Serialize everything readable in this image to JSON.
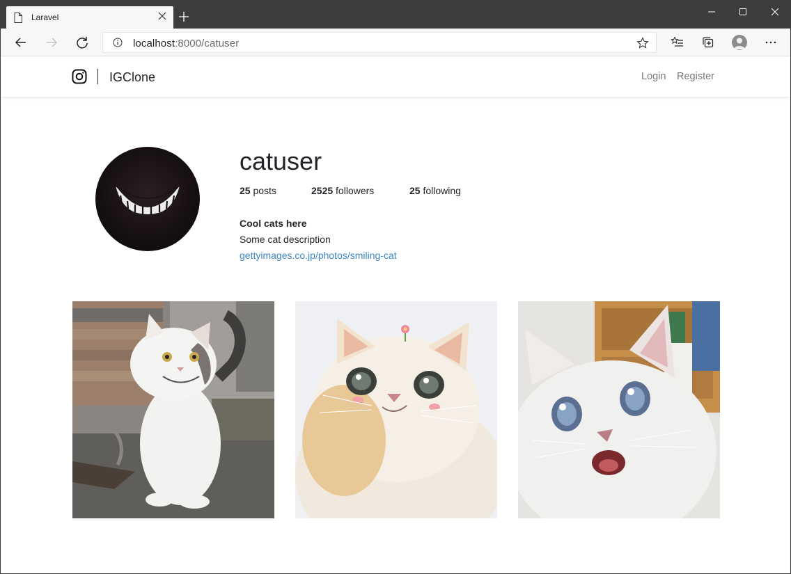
{
  "browser": {
    "tab_title": "Laravel",
    "url_host": "localhost",
    "url_path": ":8000/catuser"
  },
  "navbar": {
    "brand": "IGClone",
    "login": "Login",
    "register": "Register"
  },
  "profile": {
    "username": "catuser",
    "posts_count": "25",
    "posts_label": "posts",
    "followers_count": "2525",
    "followers_label": "followers",
    "following_count": "25",
    "following_label": "following",
    "bio_title": "Cool cats here",
    "bio_description": "Some cat description",
    "bio_link": "gettyimages.co.jp/photos/smiling-cat"
  },
  "posts": [
    {
      "alt": "smiling white and grey cat sitting outdoors"
    },
    {
      "alt": "fluffy white cat with big eyes and a flower"
    },
    {
      "alt": "surprised white cat with blue eyes"
    }
  ],
  "colors": {
    "link": "#3d86c6",
    "titlebar": "#3c3c3c",
    "toolbar": "#f7f7f7"
  }
}
